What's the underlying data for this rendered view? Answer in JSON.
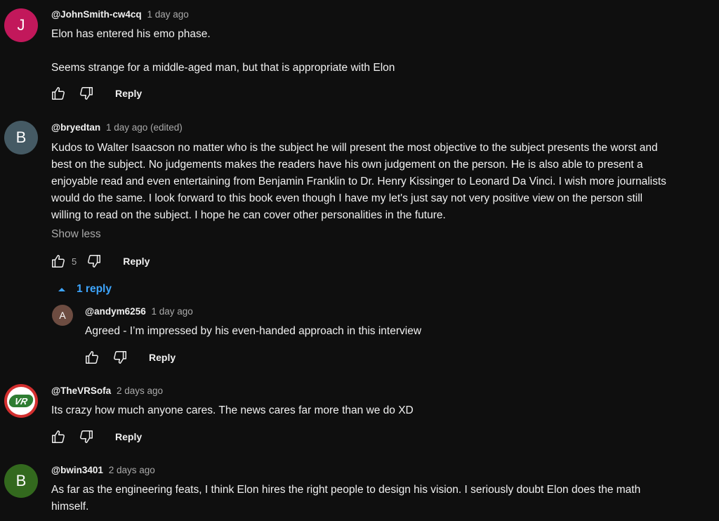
{
  "comments": [
    {
      "avatar_letter": "J",
      "avatar_color": "#c2185b",
      "author": "@JohnSmith-cw4cq",
      "time": "1 day ago",
      "body_p1": "Elon has entered his emo phase.",
      "body_p2": "Seems strange for a middle-aged man, but that is appropriate with Elon",
      "reply_label": "Reply"
    },
    {
      "avatar_letter": "B",
      "avatar_color": "#455a64",
      "author": "@bryedtan",
      "time": "1 day ago (edited)",
      "body_lines": [
        "Kudos to Walter Isaacson no matter who is the subject he will present the most objective to the subject presents the worst and",
        "best on the subject. No judgements makes the readers have his own judgement on the person. He is also able to present a",
        "enjoyable read and even entertaining from Benjamin Franklin to Dr. Henry Kissinger to Leonard Da Vinci. I wish more journalists",
        "would do the same. I look forward to this book even though I have my let's just say not very positive view on the person still",
        "willing to read on the subject. I hope he can cover other personalities in the future."
      ],
      "show_less": "Show less",
      "likes": "5",
      "reply_label": "Reply",
      "replies_toggle": "1 reply"
    },
    {
      "avatar_letter": "A",
      "avatar_color": "#6d4c41",
      "author": "@andym6256",
      "time": "1 day ago",
      "body": "Agreed - I’m impressed by his even-handed approach in this interview",
      "reply_label": "Reply"
    },
    {
      "avatar_letter": "VR",
      "avatar_color": "#d32f2f",
      "avatar_accent": "#2e7d32",
      "author": "@TheVRSofa",
      "time": "2 days ago",
      "body": "Its crazy how much anyone cares. The news cares far more than we do XD",
      "reply_label": "Reply"
    },
    {
      "avatar_letter": "B",
      "avatar_color": "#33691e",
      "author": "@bwin3401",
      "time": "2 days ago",
      "body_lines": [
        "As far as the engineering feats, I think Elon hires the right people to design his vision. I seriously doubt Elon does the math",
        "himself."
      ]
    }
  ],
  "icons": {
    "like": "thumbs-up-icon",
    "dislike": "thumbs-down-icon",
    "caret": "caret-up-icon"
  },
  "colors": {
    "background": "#0f0f0f",
    "link": "#3ea6ff",
    "secondary_text": "#aaaaaa"
  }
}
